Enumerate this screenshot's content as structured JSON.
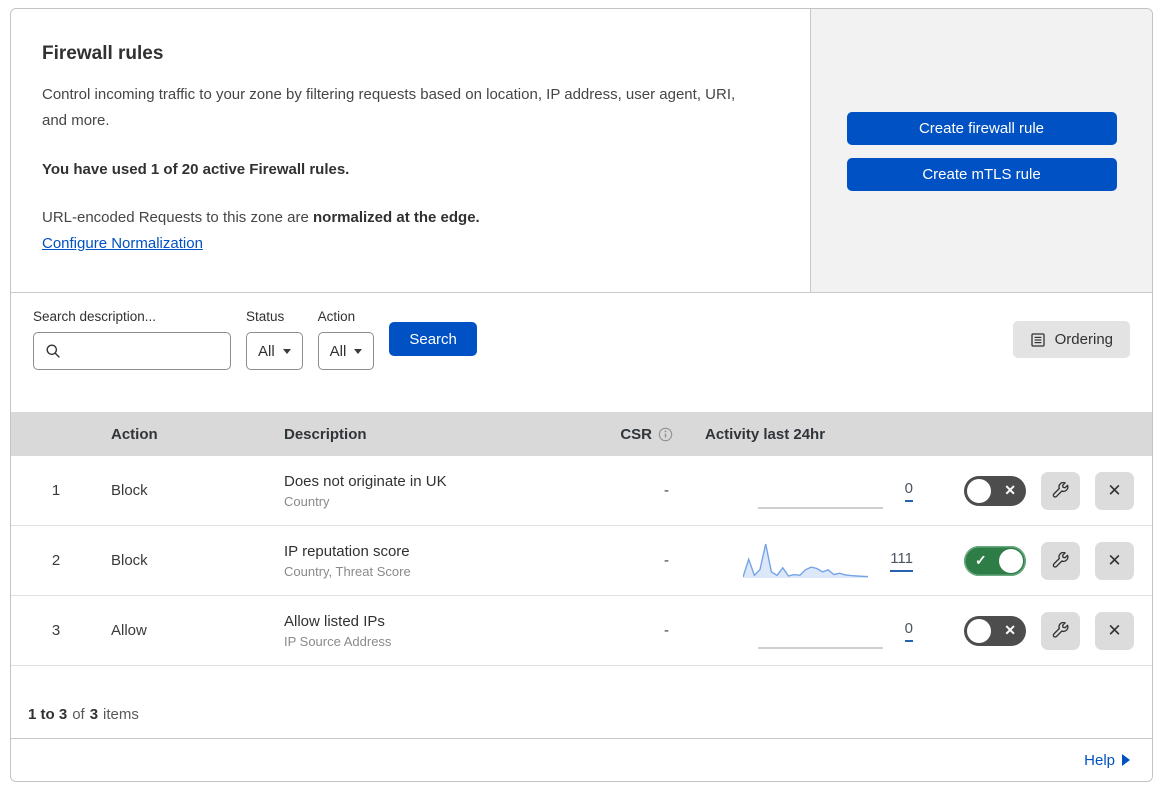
{
  "header": {
    "title": "Firewall rules",
    "description": "Control incoming traffic to your zone by filtering requests based on location, IP address, user agent, URI, and more.",
    "usage": "You have used 1 of 20 active Firewall rules.",
    "normalization_prefix": "URL-encoded Requests to this zone are ",
    "normalization_bold": "normalized at the edge.",
    "normalization_link": "Configure Normalization",
    "create_firewall_button": "Create firewall rule",
    "create_mtls_button": "Create mTLS rule"
  },
  "filters": {
    "search_label": "Search description...",
    "search_value": "",
    "status_label": "Status",
    "status_value": "All",
    "action_label": "Action",
    "action_value": "All",
    "search_button": "Search",
    "ordering_button": "Ordering"
  },
  "table": {
    "columns": {
      "action": "Action",
      "description": "Description",
      "csr": "CSR",
      "activity": "Activity last 24hr"
    },
    "rows": [
      {
        "index": "1",
        "action": "Block",
        "description": "Does not originate in UK",
        "criteria": "Country",
        "csr": "-",
        "activity_count": "0",
        "enabled": false,
        "sparkline": [
          0
        ]
      },
      {
        "index": "2",
        "action": "Block",
        "description": "IP reputation score",
        "criteria": "Country, Threat Score",
        "csr": "-",
        "activity_count": "111",
        "enabled": true,
        "sparkline": [
          3,
          55,
          8,
          25,
          100,
          18,
          8,
          30,
          6,
          10,
          8,
          24,
          32,
          28,
          18,
          24,
          10,
          14,
          9,
          7,
          6,
          5,
          4
        ]
      },
      {
        "index": "3",
        "action": "Allow",
        "description": "Allow listed IPs",
        "criteria": "IP Source Address",
        "csr": "-",
        "activity_count": "0",
        "enabled": false,
        "sparkline": [
          0
        ]
      }
    ],
    "footer": {
      "range": "1 to 3",
      "of": "of",
      "total": "3",
      "items": "items"
    }
  },
  "help": {
    "label": "Help"
  },
  "icons": {
    "close": "✕",
    "check": "✓",
    "cross": "✕"
  },
  "colors": {
    "accent_blue": "#0051c3",
    "toggle_on_green": "#2e7d46",
    "toggle_off_gray": "#4d4d4d",
    "panel_gray": "#f2f2f2",
    "table_header_gray": "#d9d9d9",
    "spark_stroke": "#74a4e6",
    "spark_fill": "#dce8f8",
    "flat_line_gray": "#bfbfbf"
  }
}
